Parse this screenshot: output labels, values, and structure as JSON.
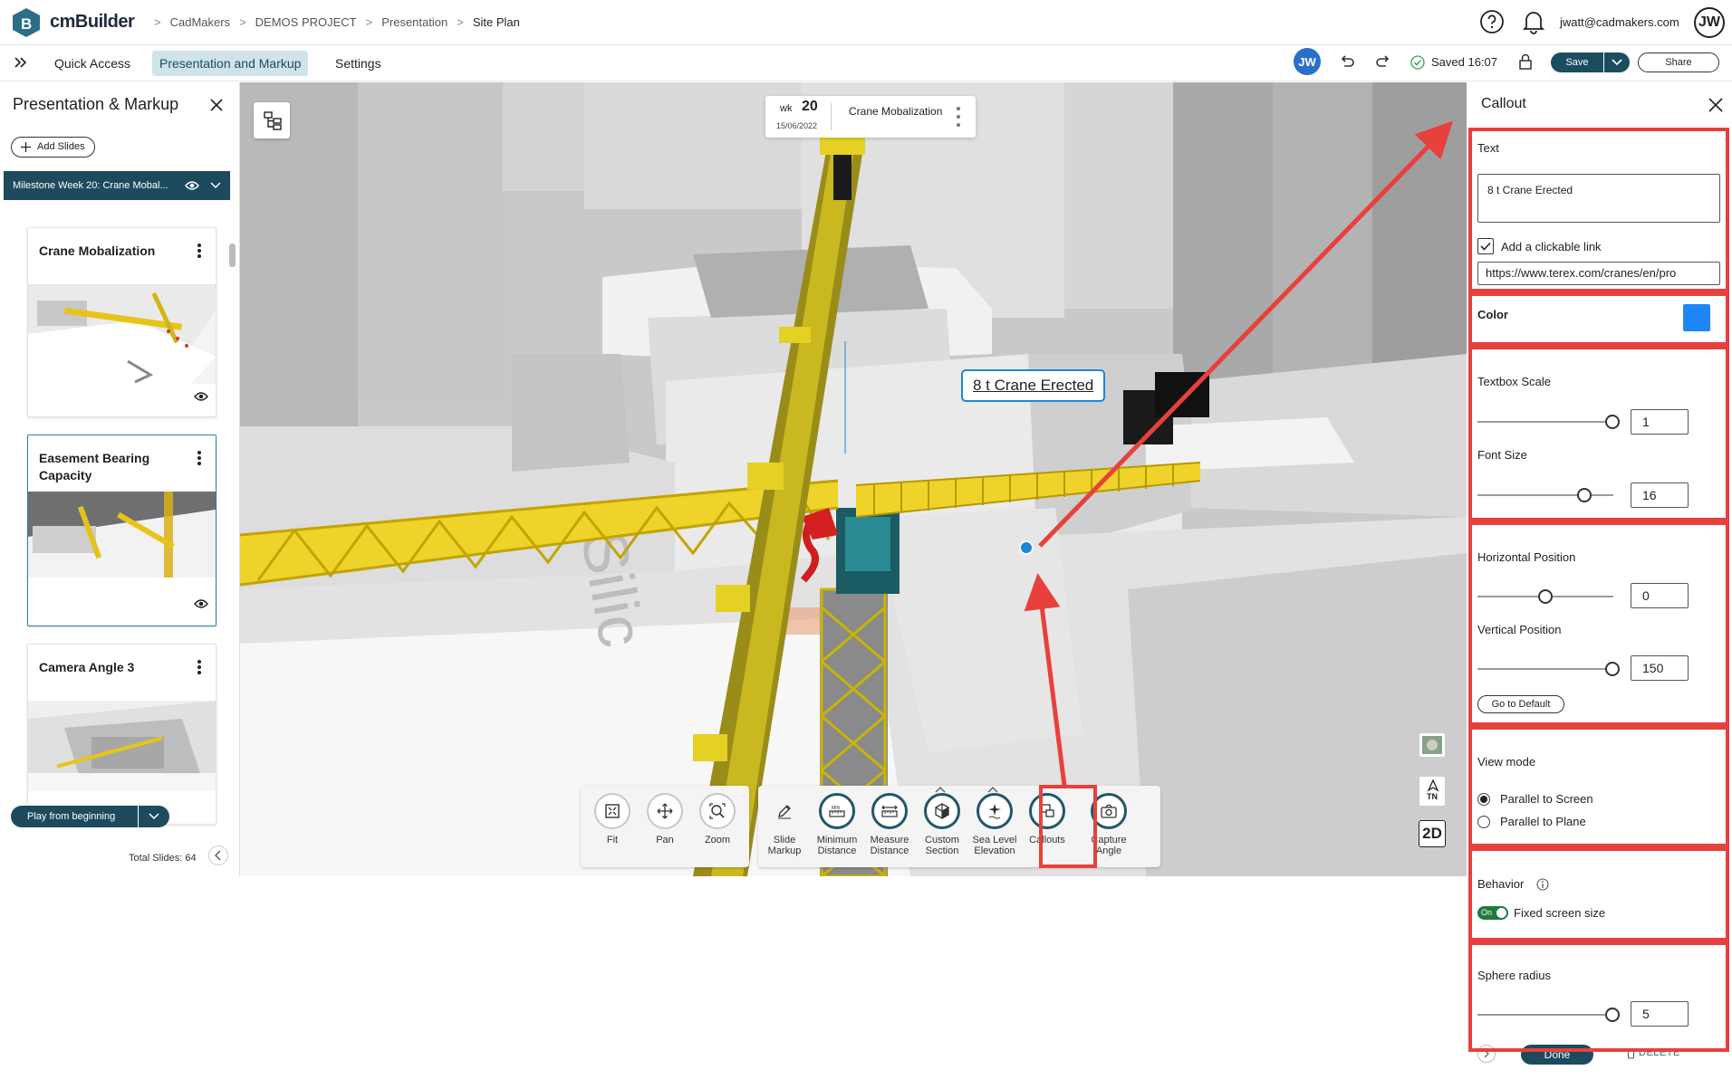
{
  "app": {
    "name": "cmBuilder"
  },
  "breadcrumb": [
    "CadMakers",
    "DEMOS PROJECT",
    "Presentation",
    "Site Plan"
  ],
  "user": {
    "email": "jwatt@cadmakers.com",
    "initials": "JW"
  },
  "toolbar": {
    "tabs": [
      "Quick Access",
      "Presentation and Markup",
      "Settings"
    ],
    "avatar_initials": "JW",
    "saved_text": "Saved 16:07",
    "save_label": "Save",
    "share_label": "Share"
  },
  "left_panel": {
    "title": "Presentation & Markup",
    "add_slides_label": "Add Slides",
    "milestone": "Milestone Week 20: Crane Mobal...",
    "slides": [
      {
        "title": "Crane Mobalization"
      },
      {
        "title": "Easement Bearing Capacity"
      },
      {
        "title": "Camera Angle 3"
      }
    ],
    "play_label": "Play from beginning",
    "total_slides": "Total Slides: 64"
  },
  "viewport": {
    "week_label": "wk",
    "week_number": "20",
    "week_date": "15/06/2022",
    "card_title": "Crane Mobalization",
    "callout_text": "8 t Crane Erected",
    "tn_label": "TN",
    "mode_2d_label": "2D"
  },
  "bottom_tools": {
    "group1": [
      {
        "label": "Fit",
        "icon": "fit-icon"
      },
      {
        "label": "Pan",
        "icon": "pan-icon"
      },
      {
        "label": "Zoom",
        "icon": "zoom-icon"
      }
    ],
    "group2": [
      {
        "label1": "Slide",
        "label2": "Markup",
        "icon": "pencil-icon"
      },
      {
        "label1": "Minimum",
        "label2": "Distance",
        "icon": "min-distance-icon"
      },
      {
        "label1": "Measure",
        "label2": "Distance",
        "icon": "measure-icon"
      },
      {
        "label1": "Custom",
        "label2": "Section",
        "icon": "section-cube-icon"
      },
      {
        "label1": "Sea Level",
        "label2": "Elevation",
        "icon": "sea-level-icon"
      },
      {
        "label1": "Callouts",
        "label2": "",
        "icon": "callout-icon"
      },
      {
        "label1": "Capture",
        "label2": "Angle",
        "icon": "camera-icon"
      }
    ]
  },
  "callout_panel": {
    "title": "Callout",
    "text_label": "Text",
    "text_value": "8 t Crane Erected",
    "link_checkbox_label": "Add a clickable link",
    "link_checked": true,
    "link_value": "https://www.terex.com/cranes/en/pro",
    "color_label": "Color",
    "color_value": "#1e87f5",
    "textbox_scale_label": "Textbox Scale",
    "textbox_scale_value": "1",
    "font_size_label": "Font Size",
    "font_size_value": "16",
    "horizontal_position_label": "Horizontal Position",
    "horizontal_position_value": "0",
    "vertical_position_label": "Vertical Position",
    "vertical_position_value": "150",
    "default_label": "Go to Default",
    "view_mode_label": "View mode",
    "view_modes": [
      "Parallel to Screen",
      "Parallel to Plane"
    ],
    "view_mode_selected": "Parallel to Screen",
    "behavior_label": "Behavior",
    "toggle_label": "On",
    "fixed_size_label": "Fixed screen size",
    "sphere_radius_label": "Sphere radius",
    "sphere_radius_value": "5",
    "done_label": "Done",
    "delete_label": "DELETE"
  },
  "colors": {
    "accent": "#1d4b5d",
    "highlight": "#e8403c",
    "callout_blue": "#1e87d6"
  }
}
